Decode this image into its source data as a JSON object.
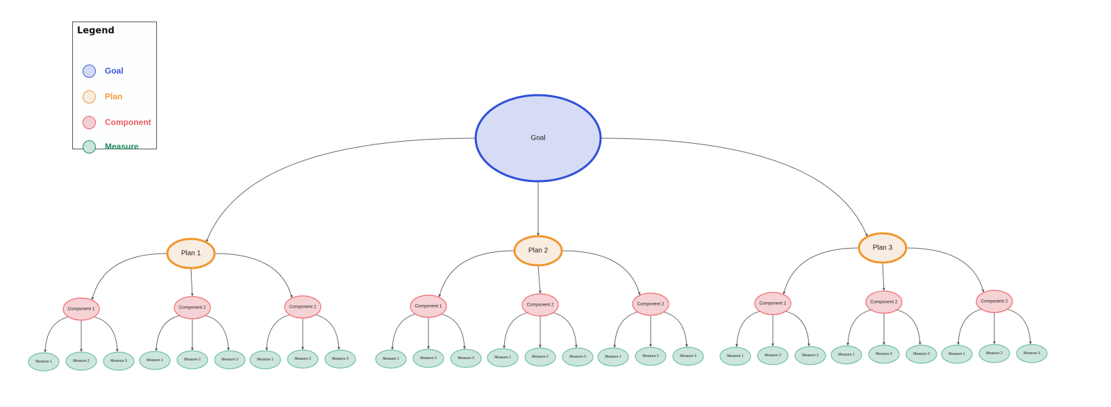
{
  "legend": {
    "title": "Legend",
    "items": [
      {
        "label": "Goal",
        "fill": "#d4daf5",
        "stroke": "#3d55d9",
        "text_color": "#3d55d9"
      },
      {
        "label": "Plan",
        "fill": "#f8ece0",
        "stroke": "#f29a3d",
        "text_color": "#f29a3d"
      },
      {
        "label": "Component",
        "fill": "#f5d0d3",
        "stroke": "#ec5b63",
        "text_color": "#ec5b63"
      },
      {
        "label": "Measure",
        "fill": "#cbe5dc",
        "stroke": "#1f8a5f",
        "text_color": "#1f8a5f"
      }
    ]
  },
  "colors": {
    "goal": {
      "fill": "#d6dcf5",
      "stroke": "#2e4fd8"
    },
    "plan": {
      "fill": "#f9ede2",
      "stroke": "#f0962f"
    },
    "component": {
      "fill": "#f5d2d4",
      "stroke": "#ee6a70"
    },
    "measure": {
      "fill": "#cce6dd",
      "stroke": "#6fc0a2"
    },
    "edge": "#666666"
  },
  "tree": {
    "label": "Goal",
    "plans": [
      {
        "label": "Plan 1",
        "components": [
          {
            "label": "Component 1",
            "measures": [
              "Measure 1",
              "Measure 2",
              "Measure 3"
            ]
          },
          {
            "label": "Component 2",
            "measures": [
              "Measure 1",
              "Measure 2",
              "Measure 3"
            ]
          },
          {
            "label": "Component 2",
            "measures": [
              "Measure 1",
              "Measure 2",
              "Measure 3"
            ]
          }
        ]
      },
      {
        "label": "Plan 2",
        "components": [
          {
            "label": "Component 1",
            "measures": [
              "Measure 1",
              "Measure 2",
              "Measure 3"
            ]
          },
          {
            "label": "Component 2",
            "measures": [
              "Measure 1",
              "Measure 2",
              "Measure 3"
            ]
          },
          {
            "label": "Component 2",
            "measures": [
              "Measure 1",
              "Measure 2",
              "Measure 3"
            ]
          }
        ]
      },
      {
        "label": "Plan 3",
        "components": [
          {
            "label": "Component 1",
            "measures": [
              "Measure 1",
              "Measure 2",
              "Measure 3"
            ]
          },
          {
            "label": "Component 2",
            "measures": [
              "Measure 1",
              "Measure 2",
              "Measure 3"
            ]
          },
          {
            "label": "Component 2",
            "measures": [
              "Measure 1",
              "Measure 2",
              "Measure 3"
            ]
          }
        ]
      }
    ]
  }
}
